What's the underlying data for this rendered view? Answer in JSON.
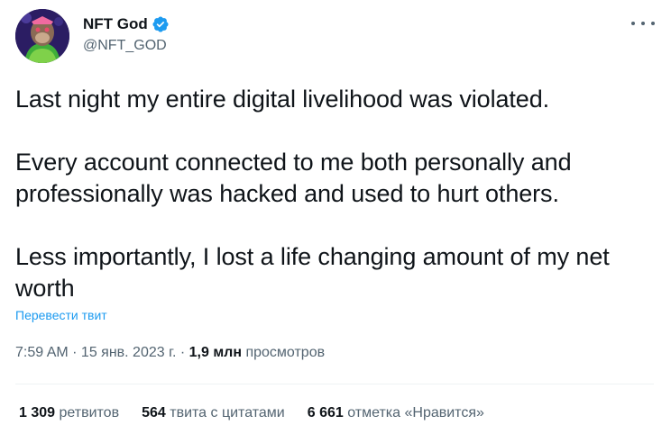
{
  "author": {
    "display_name": "NFT God",
    "handle": "@NFT_GOD",
    "verified": true,
    "avatar_icon": "ape-avatar-icon",
    "verified_icon": "verified-badge-icon"
  },
  "tweet": {
    "paragraphs": [
      "Last night my entire digital livelihood was violated.",
      "Every account connected to me both personally and professionally was hacked and used to hurt others.",
      "Less importantly, I lost a life changing amount of my net worth"
    ],
    "translate_label": "Перевести твит"
  },
  "meta": {
    "time": "7:59 AM",
    "sep1": " · ",
    "date": "15 янв. 2023 г.",
    "sep2": " · ",
    "views_count": "1,9 млн",
    "views_label": "просмотров"
  },
  "stats": {
    "retweets_count": "1 309",
    "retweets_label": "ретвитов",
    "quotes_count": "564",
    "quotes_label": "твита с цитатами",
    "likes_count": "6 661",
    "likes_label": "отметка «Нравится»"
  },
  "colors": {
    "accent": "#1d9bf0",
    "text": "#0f1419",
    "secondary": "#536471"
  }
}
